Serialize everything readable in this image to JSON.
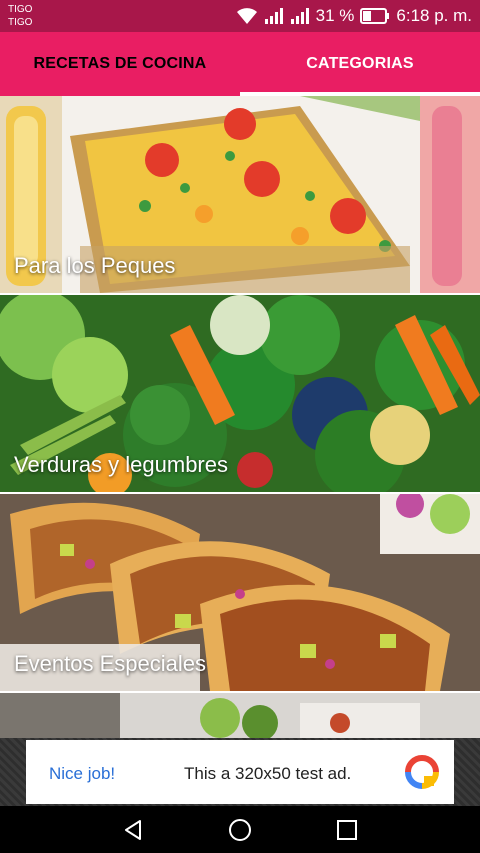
{
  "status_bar": {
    "carrier_1": "TIGO",
    "carrier_2": "TIGO",
    "battery_text": "31 %",
    "time": "6:18 p. m.",
    "icons": [
      "wifi-icon",
      "signal-icon",
      "signal-icon",
      "battery-icon"
    ]
  },
  "tabs": [
    {
      "label": "RECETAS DE COCINA",
      "active": false
    },
    {
      "label": "CATEGORIAS",
      "active": true
    }
  ],
  "categories": [
    {
      "title": "Para los Peques"
    },
    {
      "title": "Verduras y legumbres"
    },
    {
      "title": "Eventos Especiales"
    },
    {
      "title": ""
    }
  ],
  "ad": {
    "nice_text": "Nice job!",
    "body_text": "This a 320x50 test ad.",
    "logo_icon": "ad-logo-icon"
  },
  "nav": {
    "icons": [
      "back-icon",
      "home-icon",
      "recents-icon"
    ]
  },
  "colors": {
    "status_bar": "#a8174a",
    "tab_bar": "#e91e63",
    "tab_indicator": "#ffffff",
    "ad_link": "#2a6fd6"
  }
}
